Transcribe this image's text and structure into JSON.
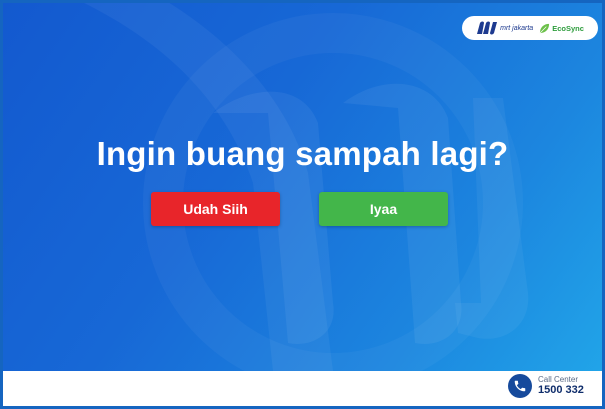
{
  "header": {
    "mrt_logo_text": "mrt jakarta",
    "mrt_logo_icon": "mrt-jakarta-logo-icon",
    "eco_logo_text": "EcoSync",
    "eco_logo_icon": "leaf-icon"
  },
  "main": {
    "question": "Ingin buang sampah lagi?",
    "no_button_label": "Udah Siih",
    "yes_button_label": "Iyaa"
  },
  "footer": {
    "call_center_label": "Call Center",
    "call_center_number": "1500 332",
    "call_icon": "phone-icon"
  },
  "colors": {
    "background_start": "#1359cf",
    "background_end": "#21a4e8",
    "no_button": "#e8252a",
    "yes_button": "#43b64a",
    "brand_navy": "#164a9c",
    "eco_green": "#2e9d3d"
  }
}
